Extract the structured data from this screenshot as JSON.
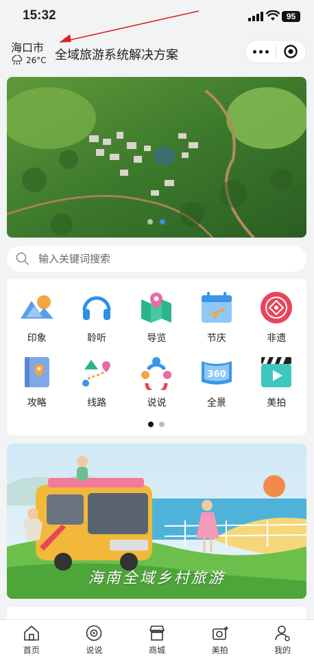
{
  "status_bar": {
    "time": "15:32",
    "battery": "95"
  },
  "header": {
    "city": "海口市",
    "temperature": "26°C",
    "title": "全域旅游系统解决方案"
  },
  "search": {
    "placeholder": "输入关键词搜索"
  },
  "menu": {
    "items": [
      {
        "label": "印象",
        "icon": "mountain-icon"
      },
      {
        "label": "聆听",
        "icon": "headphones-icon"
      },
      {
        "label": "导览",
        "icon": "map-pin-icon"
      },
      {
        "label": "节庆",
        "icon": "calendar-plane-icon"
      },
      {
        "label": "非遗",
        "icon": "heritage-icon"
      },
      {
        "label": "攻略",
        "icon": "guide-book-icon"
      },
      {
        "label": "线路",
        "icon": "route-icon"
      },
      {
        "label": "说说",
        "icon": "people-icon"
      },
      {
        "label": "全景",
        "icon": "panorama-360-icon"
      },
      {
        "label": "美拍",
        "icon": "video-icon"
      }
    ]
  },
  "promo": {
    "caption": "海南全域乡村旅游"
  },
  "tabbar": {
    "items": [
      {
        "label": "首页",
        "icon": "home-icon"
      },
      {
        "label": "说说",
        "icon": "chat-icon"
      },
      {
        "label": "商城",
        "icon": "shop-icon"
      },
      {
        "label": "美拍",
        "icon": "camera-icon"
      },
      {
        "label": "我的",
        "icon": "user-icon"
      }
    ]
  },
  "colors": {
    "accent": "#3a8ee6",
    "arrow": "#e02020"
  }
}
